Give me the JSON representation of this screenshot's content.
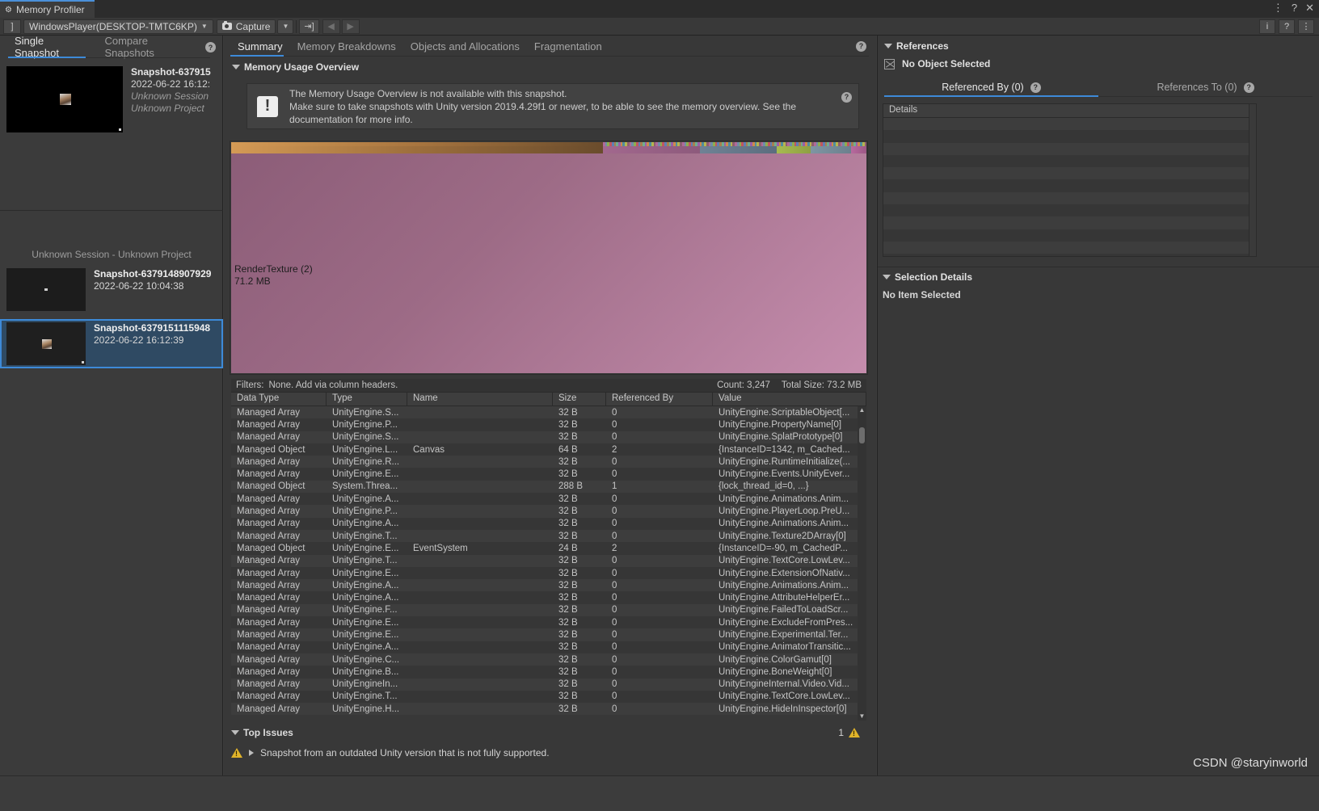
{
  "window": {
    "title": "Memory Profiler",
    "minimize": "⋮",
    "help": "?",
    "close": "✕"
  },
  "toolbar": {
    "left_icon": "]",
    "target_dropdown": "WindowsPlayer(DESKTOP-TMTC6KP)",
    "capture_label": "Capture",
    "import_icon": "import-icon",
    "back_icon": "◀",
    "forward_icon": "▶",
    "info_icon": "i",
    "help_icon": "?",
    "menu_icon": "⋮"
  },
  "left_pane": {
    "tabs": [
      {
        "label": "Single Snapshot",
        "active": true
      },
      {
        "label": "Compare Snapshots",
        "active": false
      }
    ],
    "help_icon": "?",
    "hero": {
      "name": "Snapshot-637915",
      "date": "2022-06-22 16:12:",
      "session": "Unknown Session",
      "project": "Unknown Project"
    },
    "session_header": "Unknown Session - Unknown Project",
    "snapshots": [
      {
        "name": "Snapshot-6379148907929",
        "date": "2022-06-22 10:04:38",
        "selected": false
      },
      {
        "name": "Snapshot-6379151115948",
        "date": "2022-06-22 16:12:39",
        "selected": true
      }
    ]
  },
  "center_pane": {
    "tabs": [
      {
        "label": "Summary",
        "active": true
      },
      {
        "label": "Memory Breakdowns",
        "active": false
      },
      {
        "label": "Objects and Allocations",
        "active": false
      },
      {
        "label": "Fragmentation",
        "active": false
      }
    ],
    "help_icon": "?",
    "section_title": "Memory Usage Overview",
    "info_box": {
      "icon": "!",
      "line1": "The Memory Usage Overview is not available with this snapshot.",
      "line2": "Make sure to take snapshots with Unity version 2019.4.29f1 or newer, to be able to see the memory overview. See the",
      "line3": "documentation for more info.",
      "help_icon": "?"
    },
    "treemap": {
      "label_name": "RenderTexture (2)",
      "label_size": "71.2 MB"
    },
    "filters": {
      "label": "Filters:",
      "value": "None. Add via column headers.",
      "count": "Count: 3,247",
      "total_size": "Total Size: 73.2 MB"
    },
    "table": {
      "columns": [
        "Data Type",
        "Type",
        "Name",
        "Size",
        "Referenced By",
        "Value"
      ],
      "rows": [
        [
          "Managed Array",
          "UnityEngine.S...",
          "",
          "32 B",
          "0",
          "UnityEngine.ScriptableObject[..."
        ],
        [
          "Managed Array",
          "UnityEngine.P...",
          "",
          "32 B",
          "0",
          "UnityEngine.PropertyName[0]"
        ],
        [
          "Managed Array",
          "UnityEngine.S...",
          "",
          "32 B",
          "0",
          "UnityEngine.SplatPrototype[0]"
        ],
        [
          "Managed Object",
          "UnityEngine.L...",
          "Canvas",
          "64 B",
          "2",
          "{InstanceID=1342, m_Cached..."
        ],
        [
          "Managed Array",
          "UnityEngine.R...",
          "",
          "32 B",
          "0",
          "UnityEngine.RuntimeInitialize(..."
        ],
        [
          "Managed Array",
          "UnityEngine.E...",
          "",
          "32 B",
          "0",
          "UnityEngine.Events.UnityEver..."
        ],
        [
          "Managed Object",
          "System.Threa...",
          "",
          "288 B",
          "1",
          "{lock_thread_id=0, ...}"
        ],
        [
          "Managed Array",
          "UnityEngine.A...",
          "",
          "32 B",
          "0",
          "UnityEngine.Animations.Anim..."
        ],
        [
          "Managed Array",
          "UnityEngine.P...",
          "",
          "32 B",
          "0",
          "UnityEngine.PlayerLoop.PreU..."
        ],
        [
          "Managed Array",
          "UnityEngine.A...",
          "",
          "32 B",
          "0",
          "UnityEngine.Animations.Anim..."
        ],
        [
          "Managed Array",
          "UnityEngine.T...",
          "",
          "32 B",
          "0",
          "UnityEngine.Texture2DArray[0]"
        ],
        [
          "Managed Object",
          "UnityEngine.E...",
          "EventSystem",
          "24 B",
          "2",
          "{InstanceID=-90, m_CachedP..."
        ],
        [
          "Managed Array",
          "UnityEngine.T...",
          "",
          "32 B",
          "0",
          "UnityEngine.TextCore.LowLev..."
        ],
        [
          "Managed Array",
          "UnityEngine.E...",
          "",
          "32 B",
          "0",
          "UnityEngine.ExtensionOfNativ..."
        ],
        [
          "Managed Array",
          "UnityEngine.A...",
          "",
          "32 B",
          "0",
          "UnityEngine.Animations.Anim..."
        ],
        [
          "Managed Array",
          "UnityEngine.A...",
          "",
          "32 B",
          "0",
          "UnityEngine.AttributeHelperEr..."
        ],
        [
          "Managed Array",
          "UnityEngine.F...",
          "",
          "32 B",
          "0",
          "UnityEngine.FailedToLoadScr..."
        ],
        [
          "Managed Array",
          "UnityEngine.E...",
          "",
          "32 B",
          "0",
          "UnityEngine.ExcludeFromPres..."
        ],
        [
          "Managed Array",
          "UnityEngine.E...",
          "",
          "32 B",
          "0",
          "UnityEngine.Experimental.Ter..."
        ],
        [
          "Managed Array",
          "UnityEngine.A...",
          "",
          "32 B",
          "0",
          "UnityEngine.AnimatorTransitic..."
        ],
        [
          "Managed Array",
          "UnityEngine.C...",
          "",
          "32 B",
          "0",
          "UnityEngine.ColorGamut[0]"
        ],
        [
          "Managed Array",
          "UnityEngine.B...",
          "",
          "32 B",
          "0",
          "UnityEngine.BoneWeight[0]"
        ],
        [
          "Managed Array",
          "UnityEngineIn...",
          "",
          "32 B",
          "0",
          "UnityEngineInternal.Video.Vid..."
        ],
        [
          "Managed Array",
          "UnityEngine.T...",
          "",
          "32 B",
          "0",
          "UnityEngine.TextCore.LowLev..."
        ],
        [
          "Managed Array",
          "UnityEngine.H...",
          "",
          "32 B",
          "0",
          "UnityEngine.HideInInspector[0]"
        ]
      ],
      "scroll_up": "▲",
      "scroll_down": "▼"
    },
    "top_issues": {
      "title": "Top Issues",
      "count": "1",
      "warning_icon": "warning-icon",
      "issue_text": "Snapshot from an outdated Unity version that is not fully supported."
    }
  },
  "right_pane": {
    "references_title": "References",
    "no_object_selected": "No Object Selected",
    "tabs": [
      {
        "label": "Referenced By (0)",
        "active": true,
        "help": "?"
      },
      {
        "label": "References To (0)",
        "active": false,
        "help": "?"
      }
    ],
    "details_column": "Details",
    "selection_details_title": "Selection Details",
    "no_item_selected": "No Item Selected"
  },
  "watermark": "CSDN @staryinworld",
  "colors": {
    "accent": "#3d8ad8",
    "panel": "#383838",
    "toolbar": "#393939",
    "treemap_main": "#9d6b86",
    "warning": "#e0b32a"
  }
}
